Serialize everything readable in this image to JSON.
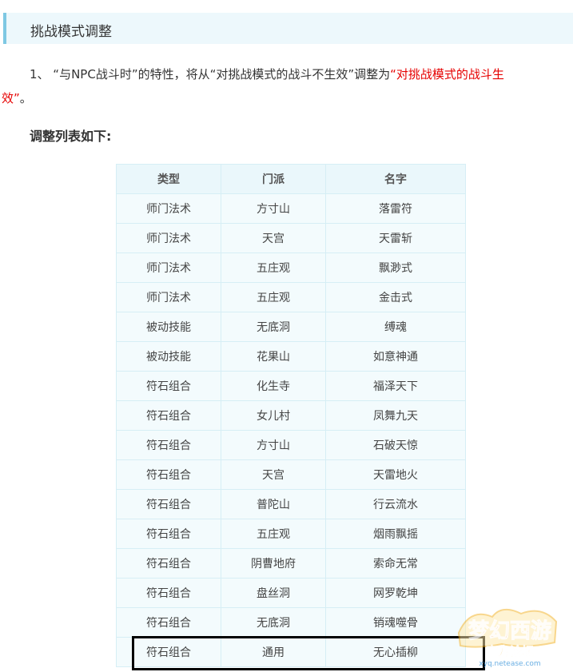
{
  "section": {
    "title": "挑战模式调整"
  },
  "paragraph": {
    "line1_prefix": "1、 “与NPC战斗时”的特性，将从“对挑战模式的战斗不生效”调整为",
    "line1_red": "“对挑战模式的战斗生",
    "line2_red": "效”",
    "line2_suffix": "。"
  },
  "subheading": "调整列表如下:",
  "table": {
    "headers": [
      "类型",
      "门派",
      "名字"
    ],
    "rows": [
      [
        "师门法术",
        "方寸山",
        "落雷符"
      ],
      [
        "师门法术",
        "天宫",
        "天雷斩"
      ],
      [
        "师门法术",
        "五庄观",
        "飘渺式"
      ],
      [
        "师门法术",
        "五庄观",
        "金击式"
      ],
      [
        "被动技能",
        "无底洞",
        "缚魂"
      ],
      [
        "被动技能",
        "花果山",
        "如意神通"
      ],
      [
        "符石组合",
        "化生寺",
        "福泽天下"
      ],
      [
        "符石组合",
        "女儿村",
        "凤舞九天"
      ],
      [
        "符石组合",
        "方寸山",
        "石破天惊"
      ],
      [
        "符石组合",
        "天宫",
        "天雷地火"
      ],
      [
        "符石组合",
        "普陀山",
        "行云流水"
      ],
      [
        "符石组合",
        "五庄观",
        "烟雨飘摇"
      ],
      [
        "符石组合",
        "阴曹地府",
        "索命无常"
      ],
      [
        "符石组合",
        "盘丝洞",
        "网罗乾坤"
      ],
      [
        "符石组合",
        "无底洞",
        "销魂噬骨"
      ],
      [
        "符石组合",
        "通用",
        "无心插柳"
      ]
    ]
  },
  "watermark": {
    "brand": "梦幻西游",
    "sub": "官方论坛",
    "url": "xyq.netease.com",
    "colors": {
      "gold": "#f2b01e",
      "orange": "#e8681a",
      "blue": "#2f8fd8"
    }
  }
}
